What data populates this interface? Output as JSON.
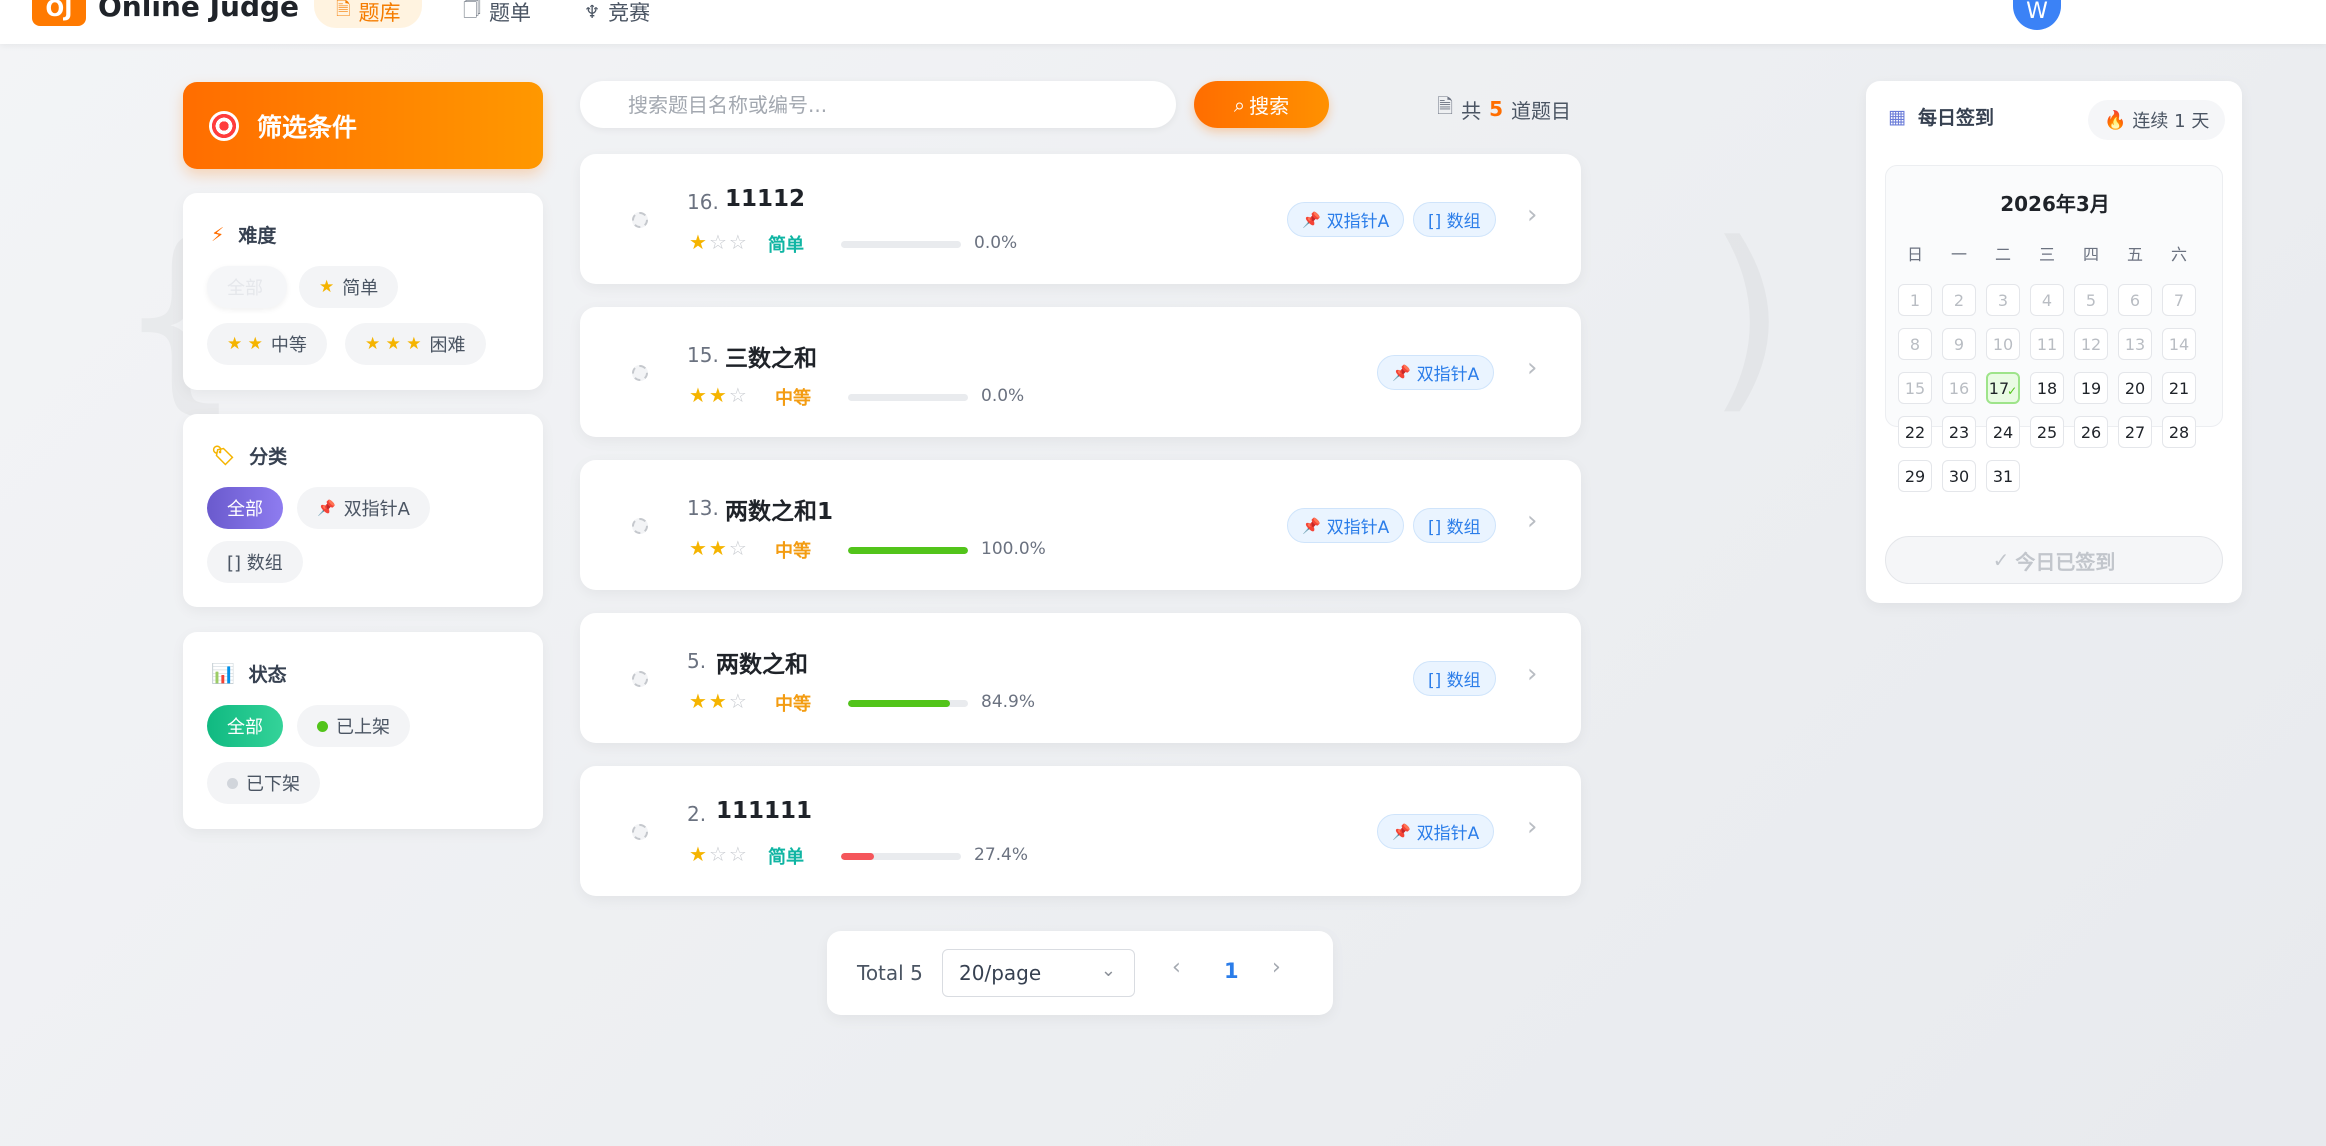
{
  "header": {
    "logo": "OJ",
    "brand": "Online Judge",
    "nav": [
      {
        "label": "题库",
        "icon": "document-icon",
        "active": true
      },
      {
        "label": "题单",
        "icon": "book-icon",
        "active": false
      },
      {
        "label": "竞赛",
        "icon": "trophy-icon",
        "active": false
      }
    ],
    "avatar_initial": "W"
  },
  "filters": {
    "title": "筛选条件",
    "difficulty": {
      "title": "难度",
      "options": [
        "全部",
        "简单",
        "中等",
        "困难"
      ]
    },
    "category": {
      "title": "分类",
      "options": [
        "全部",
        "双指针A",
        "[] 数组"
      ]
    },
    "status": {
      "title": "状态",
      "options": [
        "全部",
        "已上架",
        "已下架"
      ]
    }
  },
  "search": {
    "placeholder": "搜索题目名称或编号...",
    "button_label": "搜索"
  },
  "summary": {
    "prefix": "共",
    "count": "5",
    "suffix": "道题目"
  },
  "problems": [
    {
      "num": "16.",
      "title": "11112",
      "stars": 1,
      "difficulty": "简单",
      "pass_rate": "0.0%",
      "pass_fraction": 0.0,
      "tags": [
        "双指针A",
        "[] 数组"
      ]
    },
    {
      "num": "15.",
      "title": "三数之和",
      "stars": 2,
      "difficulty": "中等",
      "pass_rate": "0.0%",
      "pass_fraction": 0.0,
      "tags": [
        "双指针A"
      ]
    },
    {
      "num": "13.",
      "title": "两数之和1",
      "stars": 2,
      "difficulty": "中等",
      "pass_rate": "100.0%",
      "pass_fraction": 1.0,
      "tags": [
        "双指针A",
        "[] 数组"
      ]
    },
    {
      "num": "5.",
      "title": "两数之和",
      "stars": 2,
      "difficulty": "中等",
      "pass_rate": "84.9%",
      "pass_fraction": 0.849,
      "tags": [
        "[] 数组"
      ]
    },
    {
      "num": "2.",
      "title": "111111",
      "stars": 1,
      "difficulty": "简单",
      "pass_rate": "27.4%",
      "pass_fraction": 0.274,
      "tags": [
        "双指针A"
      ]
    }
  ],
  "pagination": {
    "total": "Total 5",
    "page_size": "20/page",
    "current_page": "1"
  },
  "checkin": {
    "title": "每日签到",
    "streak": "连续 1 天",
    "month": "2026年3月",
    "weekdays": [
      "日",
      "一",
      "二",
      "三",
      "四",
      "五",
      "六"
    ],
    "days": [
      "1",
      "2",
      "3",
      "4",
      "5",
      "6",
      "7",
      "8",
      "9",
      "10",
      "11",
      "12",
      "13",
      "14",
      "15",
      "16",
      "17",
      "18",
      "19",
      "20",
      "21",
      "22",
      "23",
      "24",
      "25",
      "26",
      "27",
      "28",
      "29",
      "30",
      "31"
    ],
    "today": "17",
    "today_mark": "✓",
    "button_label": "今日已签到"
  },
  "colors": {
    "accent": "#ff7a00",
    "easy": "#10b5a3",
    "medium": "#f39c12",
    "tag_blue": "#2b7de9",
    "bar_green": "#52c41a",
    "bar_red": "#f5565b"
  }
}
